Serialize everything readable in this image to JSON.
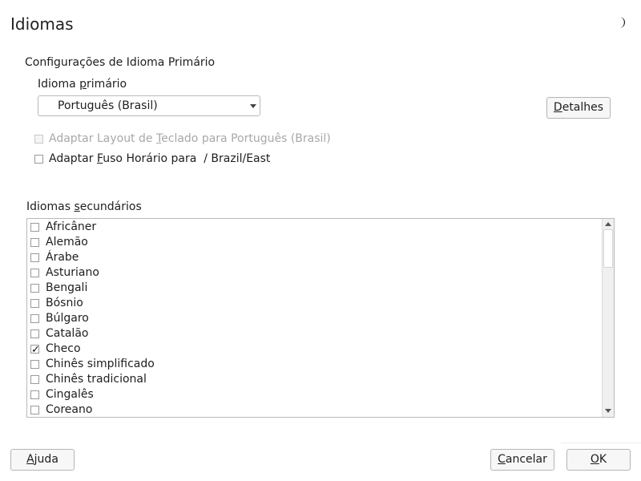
{
  "window": {
    "title": "Idiomas",
    "status_icon": "moon-icon"
  },
  "primary": {
    "section_label": "Configurações de Idioma Primário",
    "field_label": "Idioma primário",
    "selected": "Português (Brasil)",
    "details_button": "Detalhes",
    "adapt_keyboard_label": "Adaptar Layout de Teclado para Português (Brasil)",
    "adapt_keyboard_checked": false,
    "adapt_keyboard_enabled": false,
    "adapt_timezone_label": "Adaptar Fuso Horário para  / Brazil/East",
    "adapt_timezone_checked": false
  },
  "secondary": {
    "label": "Idiomas secundários",
    "items": [
      {
        "label": "Africâner",
        "checked": false
      },
      {
        "label": "Alemão",
        "checked": false
      },
      {
        "label": "Árabe",
        "checked": false
      },
      {
        "label": "Asturiano",
        "checked": false
      },
      {
        "label": "Bengali",
        "checked": false
      },
      {
        "label": "Bósnio",
        "checked": false
      },
      {
        "label": "Búlgaro",
        "checked": false
      },
      {
        "label": "Catalão",
        "checked": false
      },
      {
        "label": "Checo",
        "checked": true
      },
      {
        "label": "Chinês simplificado",
        "checked": false
      },
      {
        "label": "Chinês tradicional",
        "checked": false
      },
      {
        "label": "Cingalês",
        "checked": false
      },
      {
        "label": "Coreano",
        "checked": false
      }
    ]
  },
  "footer": {
    "help_button": "Ajuda",
    "cancel_button": "Cancelar",
    "ok_button": "OK"
  }
}
